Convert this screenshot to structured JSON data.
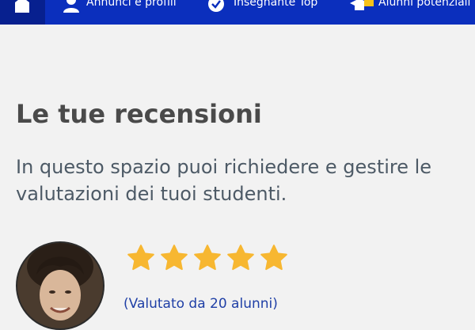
{
  "nav": {
    "items": [
      {
        "label": "Annunci e profili",
        "icon": "person-icon"
      },
      {
        "label": "Insegnante Top",
        "icon": "badge-check-icon"
      },
      {
        "label": "Alunni potenziali",
        "icon": "graduation-cap-icon"
      }
    ],
    "home_icon": "home-icon"
  },
  "main": {
    "title": "Le tue recensioni",
    "description": "In questo spazio puoi richiedere e gestire le valutazioni dei tuoi studenti."
  },
  "rating": {
    "stars": 5,
    "max_stars": 5,
    "count_text": "(Valutato da 20 alunni)"
  },
  "colors": {
    "nav_bg": "#0b2fbd",
    "nav_active_bg": "#07208f",
    "page_bg": "#f2f2f2",
    "star": "#f7b731",
    "link": "#1f3fa6"
  }
}
